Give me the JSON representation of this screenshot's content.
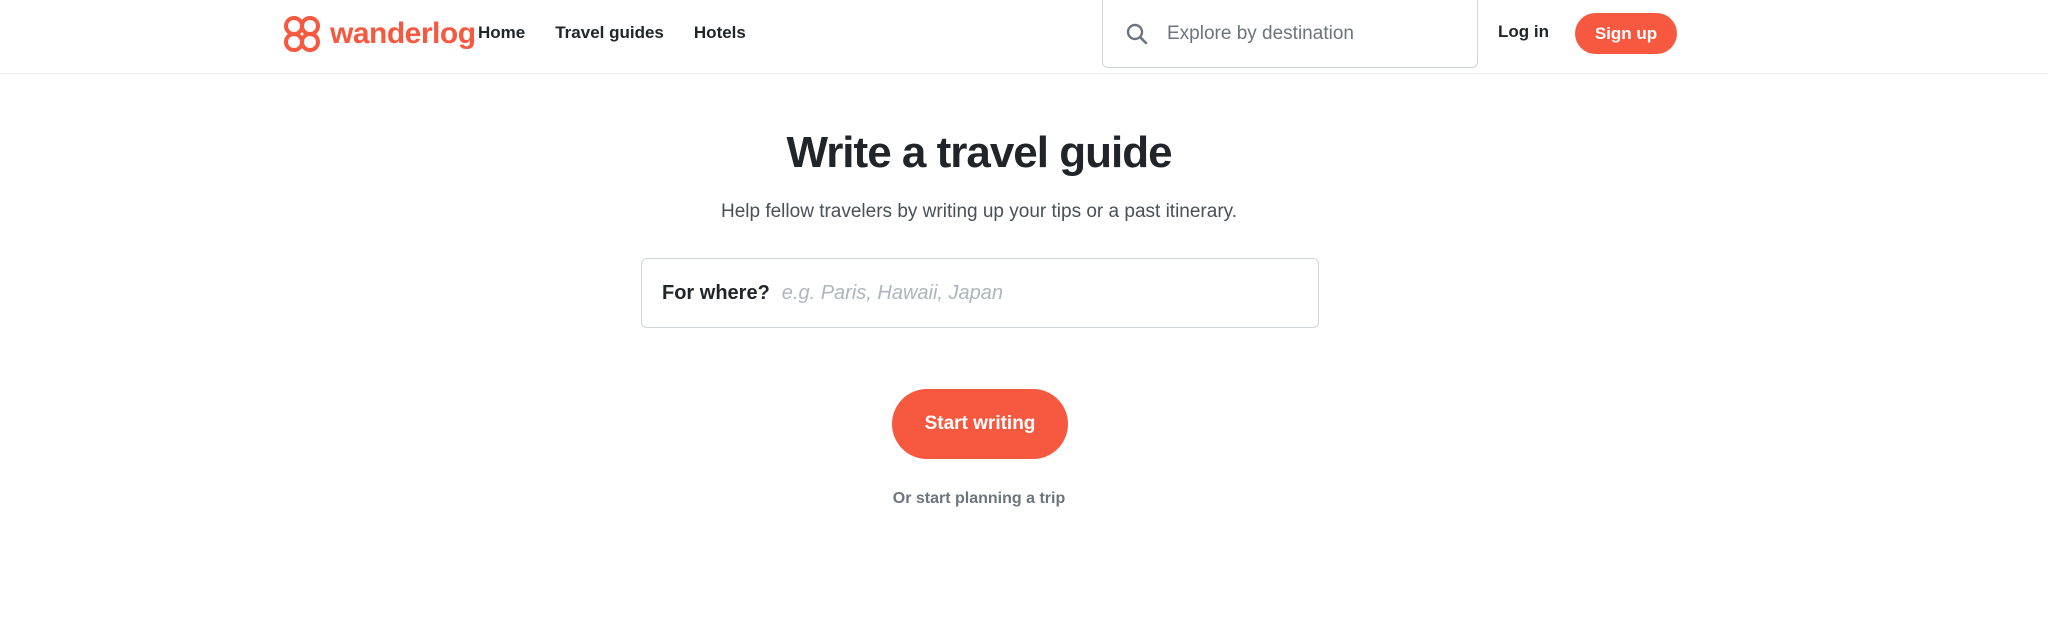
{
  "brand": {
    "name": "wanderlog",
    "logo_icon": "wanderlog-logo-icon",
    "color": "#f75940"
  },
  "nav": {
    "items": [
      {
        "label": "Home"
      },
      {
        "label": "Travel guides"
      },
      {
        "label": "Hotels"
      }
    ]
  },
  "search": {
    "icon": "search-icon",
    "placeholder": "Explore by destination"
  },
  "auth": {
    "login_label": "Log in",
    "signup_label": "Sign up"
  },
  "main": {
    "title": "Write a travel guide",
    "subtitle": "Help fellow travelers by writing up your tips or a past itinerary.",
    "where_label": "For where?",
    "where_placeholder": "e.g. Paris, Hawaii, Japan",
    "start_button": "Start writing",
    "alt_link": "Or start planning a trip"
  },
  "colors": {
    "accent": "#f75940",
    "text": "#212529",
    "muted": "#6c757d",
    "border": "#ced4da"
  }
}
